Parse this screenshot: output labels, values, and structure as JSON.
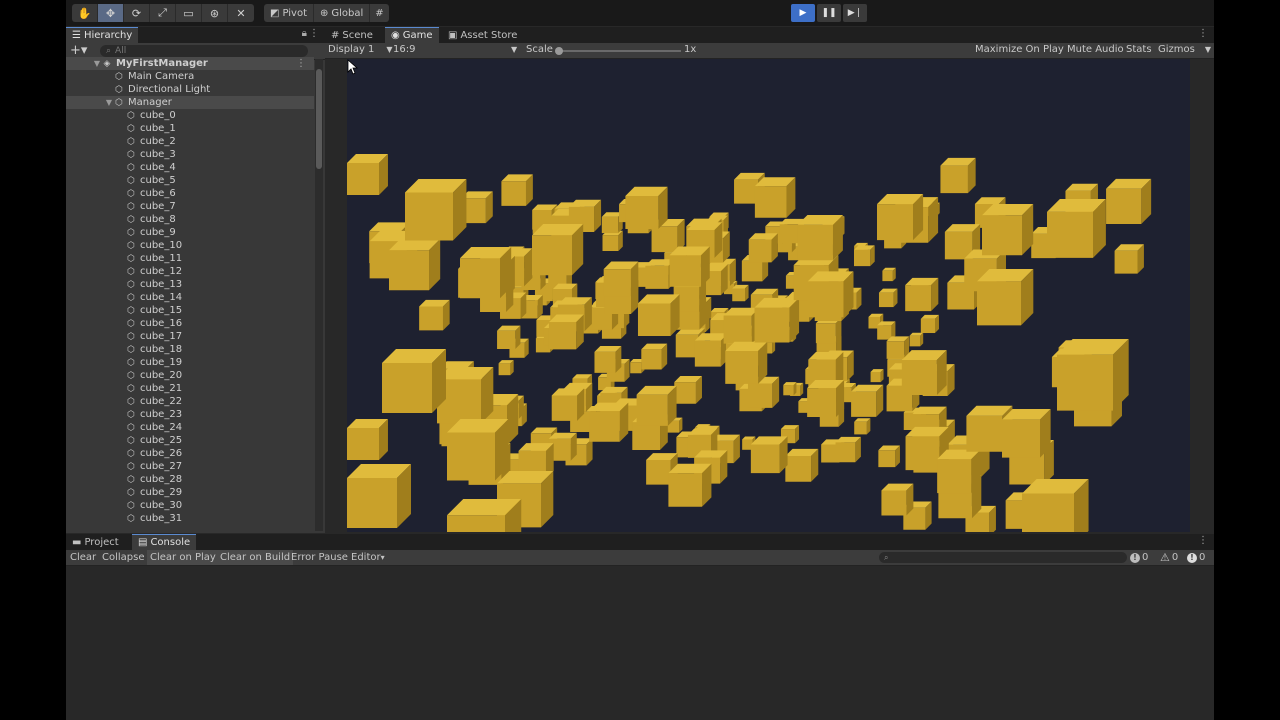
{
  "toolbar": {
    "pivot_label": "Pivot",
    "global_label": "Global"
  },
  "hierarchy": {
    "tab_label": "Hierarchy",
    "search_placeholder": "All",
    "scene_name": "MyFirstManager",
    "items": [
      "Main Camera",
      "Directional Light",
      "Manager"
    ],
    "children": [
      "cube_0",
      "cube_1",
      "cube_2",
      "cube_3",
      "cube_4",
      "cube_5",
      "cube_6",
      "cube_7",
      "cube_8",
      "cube_9",
      "cube_10",
      "cube_11",
      "cube_12",
      "cube_13",
      "cube_14",
      "cube_15",
      "cube_16",
      "cube_17",
      "cube_18",
      "cube_19",
      "cube_20",
      "cube_21",
      "cube_22",
      "cube_23",
      "cube_24",
      "cube_25",
      "cube_26",
      "cube_27",
      "cube_28",
      "cube_29",
      "cube_30",
      "cube_31"
    ]
  },
  "game_view": {
    "tabs": [
      "Scene",
      "Game",
      "Asset Store"
    ],
    "display": "Display 1",
    "aspect": "16:9",
    "scale_label": "Scale",
    "scale_value": "1x",
    "maximize": "Maximize On Play",
    "mute": "Mute Audio",
    "stats": "Stats",
    "gizmos": "Gizmos",
    "cube_color": "#c9a12a",
    "background_color": "#1e2130"
  },
  "console": {
    "tabs": [
      "Project",
      "Console"
    ],
    "buttons": [
      "Clear",
      "Collapse",
      "Clear on Play",
      "Clear on Build",
      "Error Pause",
      "Editor"
    ],
    "counts": {
      "info": "0",
      "warning": "0",
      "error": "0"
    }
  }
}
